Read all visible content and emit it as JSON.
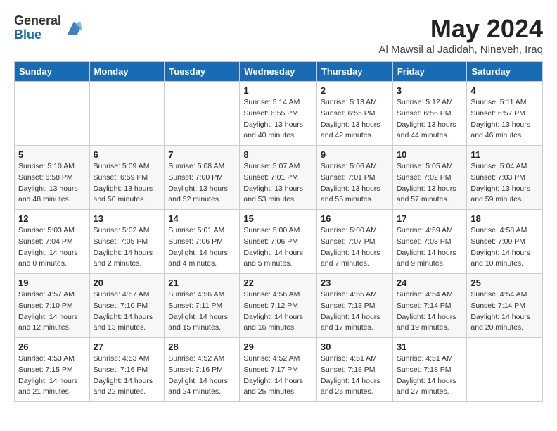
{
  "header": {
    "logo_general": "General",
    "logo_blue": "Blue",
    "month_title": "May 2024",
    "location": "Al Mawsil al Jadidah, Nineveh, Iraq"
  },
  "days_of_week": [
    "Sunday",
    "Monday",
    "Tuesday",
    "Wednesday",
    "Thursday",
    "Friday",
    "Saturday"
  ],
  "weeks": [
    [
      {
        "day": "",
        "sunrise": "",
        "sunset": "",
        "daylight": ""
      },
      {
        "day": "",
        "sunrise": "",
        "sunset": "",
        "daylight": ""
      },
      {
        "day": "",
        "sunrise": "",
        "sunset": "",
        "daylight": ""
      },
      {
        "day": "1",
        "sunrise": "Sunrise: 5:14 AM",
        "sunset": "Sunset: 6:55 PM",
        "daylight": "Daylight: 13 hours and 40 minutes."
      },
      {
        "day": "2",
        "sunrise": "Sunrise: 5:13 AM",
        "sunset": "Sunset: 6:55 PM",
        "daylight": "Daylight: 13 hours and 42 minutes."
      },
      {
        "day": "3",
        "sunrise": "Sunrise: 5:12 AM",
        "sunset": "Sunset: 6:56 PM",
        "daylight": "Daylight: 13 hours and 44 minutes."
      },
      {
        "day": "4",
        "sunrise": "Sunrise: 5:11 AM",
        "sunset": "Sunset: 6:57 PM",
        "daylight": "Daylight: 13 hours and 46 minutes."
      }
    ],
    [
      {
        "day": "5",
        "sunrise": "Sunrise: 5:10 AM",
        "sunset": "Sunset: 6:58 PM",
        "daylight": "Daylight: 13 hours and 48 minutes."
      },
      {
        "day": "6",
        "sunrise": "Sunrise: 5:09 AM",
        "sunset": "Sunset: 6:59 PM",
        "daylight": "Daylight: 13 hours and 50 minutes."
      },
      {
        "day": "7",
        "sunrise": "Sunrise: 5:08 AM",
        "sunset": "Sunset: 7:00 PM",
        "daylight": "Daylight: 13 hours and 52 minutes."
      },
      {
        "day": "8",
        "sunrise": "Sunrise: 5:07 AM",
        "sunset": "Sunset: 7:01 PM",
        "daylight": "Daylight: 13 hours and 53 minutes."
      },
      {
        "day": "9",
        "sunrise": "Sunrise: 5:06 AM",
        "sunset": "Sunset: 7:01 PM",
        "daylight": "Daylight: 13 hours and 55 minutes."
      },
      {
        "day": "10",
        "sunrise": "Sunrise: 5:05 AM",
        "sunset": "Sunset: 7:02 PM",
        "daylight": "Daylight: 13 hours and 57 minutes."
      },
      {
        "day": "11",
        "sunrise": "Sunrise: 5:04 AM",
        "sunset": "Sunset: 7:03 PM",
        "daylight": "Daylight: 13 hours and 59 minutes."
      }
    ],
    [
      {
        "day": "12",
        "sunrise": "Sunrise: 5:03 AM",
        "sunset": "Sunset: 7:04 PM",
        "daylight": "Daylight: 14 hours and 0 minutes."
      },
      {
        "day": "13",
        "sunrise": "Sunrise: 5:02 AM",
        "sunset": "Sunset: 7:05 PM",
        "daylight": "Daylight: 14 hours and 2 minutes."
      },
      {
        "day": "14",
        "sunrise": "Sunrise: 5:01 AM",
        "sunset": "Sunset: 7:06 PM",
        "daylight": "Daylight: 14 hours and 4 minutes."
      },
      {
        "day": "15",
        "sunrise": "Sunrise: 5:00 AM",
        "sunset": "Sunset: 7:06 PM",
        "daylight": "Daylight: 14 hours and 5 minutes."
      },
      {
        "day": "16",
        "sunrise": "Sunrise: 5:00 AM",
        "sunset": "Sunset: 7:07 PM",
        "daylight": "Daylight: 14 hours and 7 minutes."
      },
      {
        "day": "17",
        "sunrise": "Sunrise: 4:59 AM",
        "sunset": "Sunset: 7:08 PM",
        "daylight": "Daylight: 14 hours and 9 minutes."
      },
      {
        "day": "18",
        "sunrise": "Sunrise: 4:58 AM",
        "sunset": "Sunset: 7:09 PM",
        "daylight": "Daylight: 14 hours and 10 minutes."
      }
    ],
    [
      {
        "day": "19",
        "sunrise": "Sunrise: 4:57 AM",
        "sunset": "Sunset: 7:10 PM",
        "daylight": "Daylight: 14 hours and 12 minutes."
      },
      {
        "day": "20",
        "sunrise": "Sunrise: 4:57 AM",
        "sunset": "Sunset: 7:10 PM",
        "daylight": "Daylight: 14 hours and 13 minutes."
      },
      {
        "day": "21",
        "sunrise": "Sunrise: 4:56 AM",
        "sunset": "Sunset: 7:11 PM",
        "daylight": "Daylight: 14 hours and 15 minutes."
      },
      {
        "day": "22",
        "sunrise": "Sunrise: 4:56 AM",
        "sunset": "Sunset: 7:12 PM",
        "daylight": "Daylight: 14 hours and 16 minutes."
      },
      {
        "day": "23",
        "sunrise": "Sunrise: 4:55 AM",
        "sunset": "Sunset: 7:13 PM",
        "daylight": "Daylight: 14 hours and 17 minutes."
      },
      {
        "day": "24",
        "sunrise": "Sunrise: 4:54 AM",
        "sunset": "Sunset: 7:14 PM",
        "daylight": "Daylight: 14 hours and 19 minutes."
      },
      {
        "day": "25",
        "sunrise": "Sunrise: 4:54 AM",
        "sunset": "Sunset: 7:14 PM",
        "daylight": "Daylight: 14 hours and 20 minutes."
      }
    ],
    [
      {
        "day": "26",
        "sunrise": "Sunrise: 4:53 AM",
        "sunset": "Sunset: 7:15 PM",
        "daylight": "Daylight: 14 hours and 21 minutes."
      },
      {
        "day": "27",
        "sunrise": "Sunrise: 4:53 AM",
        "sunset": "Sunset: 7:16 PM",
        "daylight": "Daylight: 14 hours and 22 minutes."
      },
      {
        "day": "28",
        "sunrise": "Sunrise: 4:52 AM",
        "sunset": "Sunset: 7:16 PM",
        "daylight": "Daylight: 14 hours and 24 minutes."
      },
      {
        "day": "29",
        "sunrise": "Sunrise: 4:52 AM",
        "sunset": "Sunset: 7:17 PM",
        "daylight": "Daylight: 14 hours and 25 minutes."
      },
      {
        "day": "30",
        "sunrise": "Sunrise: 4:51 AM",
        "sunset": "Sunset: 7:18 PM",
        "daylight": "Daylight: 14 hours and 26 minutes."
      },
      {
        "day": "31",
        "sunrise": "Sunrise: 4:51 AM",
        "sunset": "Sunset: 7:18 PM",
        "daylight": "Daylight: 14 hours and 27 minutes."
      },
      {
        "day": "",
        "sunrise": "",
        "sunset": "",
        "daylight": ""
      }
    ]
  ]
}
